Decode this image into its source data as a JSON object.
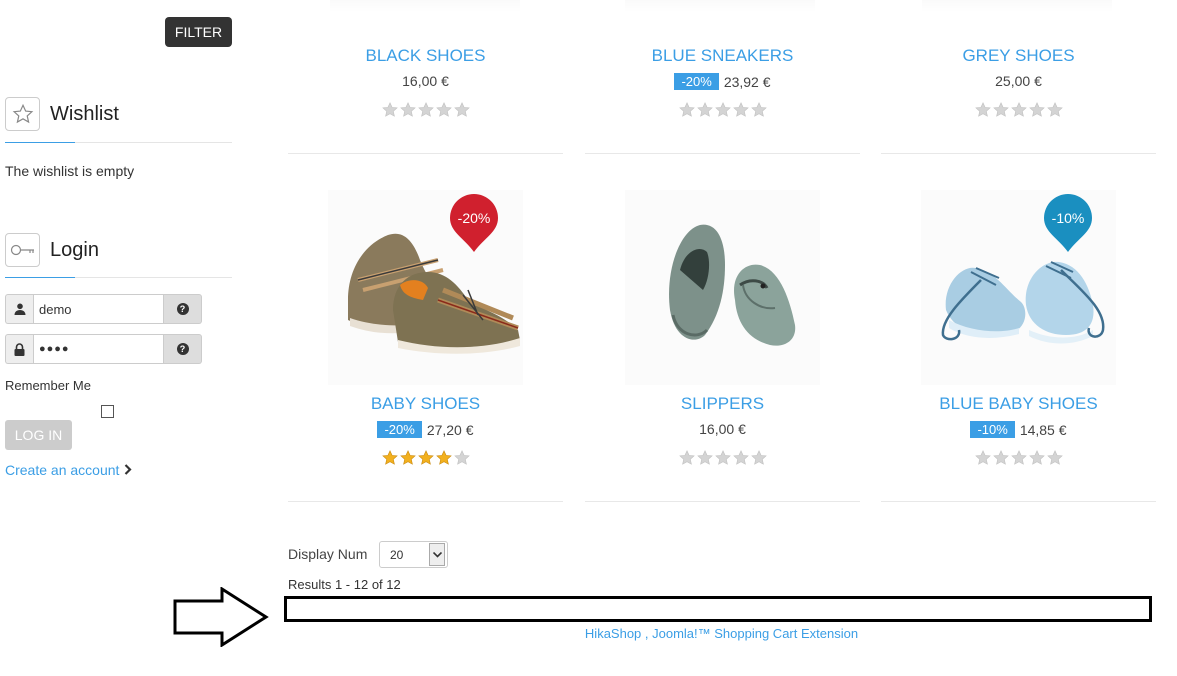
{
  "sidebar": {
    "filter_label": "FILTER",
    "wishlist": {
      "title": "Wishlist",
      "empty_text": "The wishlist is empty"
    },
    "login": {
      "title": "Login",
      "username_value": "demo",
      "password_value": "●●●●",
      "remember_label": "Remember Me",
      "login_button": "LOG IN",
      "create_account": "Create an account"
    }
  },
  "products": [
    {
      "name": "BLACK SHOES",
      "discount": "",
      "price": "16,00 €",
      "rating": 0
    },
    {
      "name": "BLUE SNEAKERS",
      "discount": "-20%",
      "price": "23,92 €",
      "rating": 0
    },
    {
      "name": "GREY SHOES",
      "discount": "",
      "price": "25,00 €",
      "rating": 0
    },
    {
      "name": "BABY SHOES",
      "discount": "-20%",
      "price": "27,20 €",
      "rating": 4,
      "badge": "-20%",
      "badge_color": "#d0202e"
    },
    {
      "name": "SLIPPERS",
      "discount": "",
      "price": "16,00 €",
      "rating": 0
    },
    {
      "name": "BLUE BABY SHOES",
      "discount": "-10%",
      "price": "14,85 €",
      "rating": 0,
      "badge": "-10%",
      "badge_color": "#1a8fc0"
    }
  ],
  "pagination": {
    "display_label": "Display Num",
    "display_value": "20",
    "results_text": "Results 1 - 12 of 12"
  },
  "footer": {
    "link_text": "HikaShop , Joomla!™ Shopping Cart Extension"
  },
  "colors": {
    "accent": "#3b9ee5",
    "dark_button": "#333333"
  }
}
